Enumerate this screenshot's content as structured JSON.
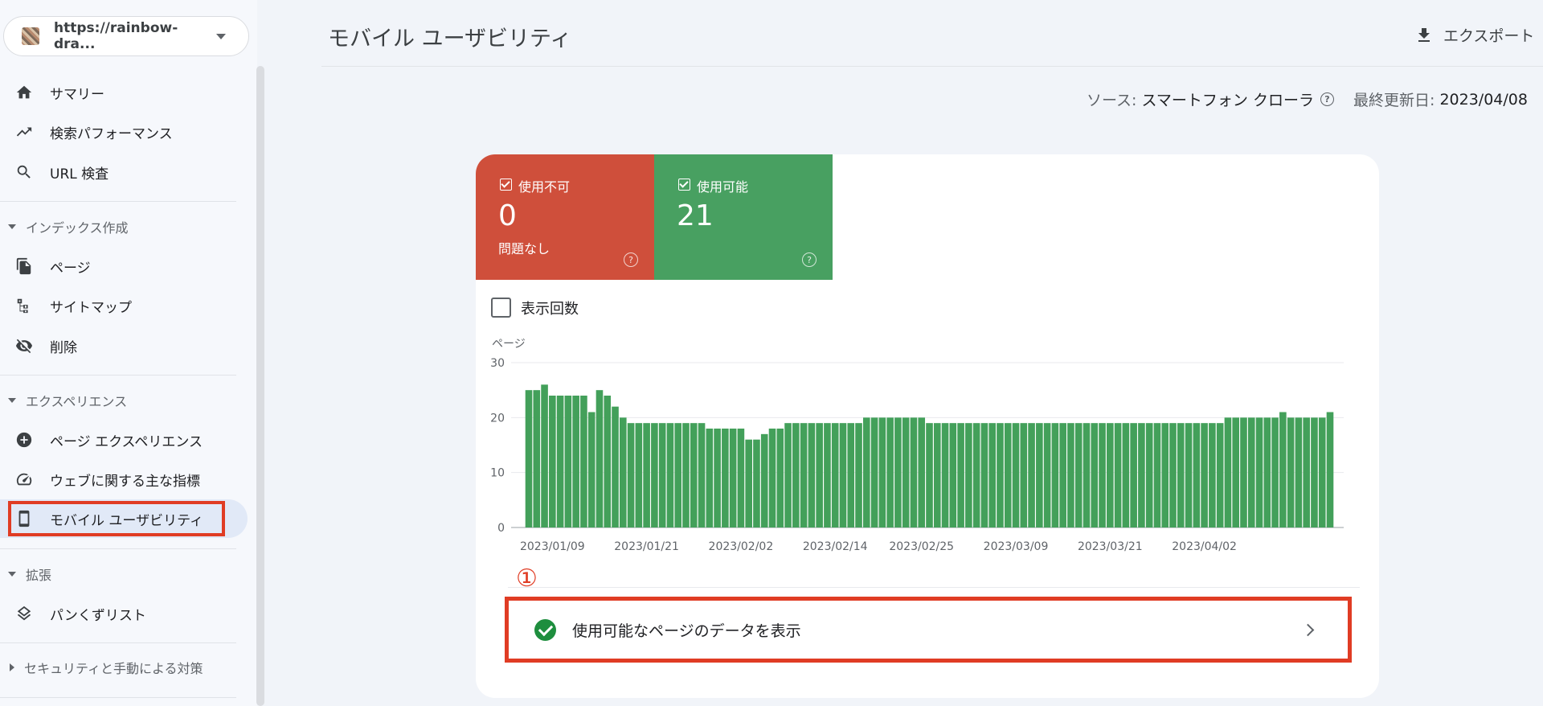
{
  "property": {
    "url": "https://rainbow-dra..."
  },
  "sidebar": {
    "items_top": [
      {
        "label": "サマリー",
        "icon": "home-icon"
      },
      {
        "label": "検索パフォーマンス",
        "icon": "trending-up-icon"
      },
      {
        "label": "URL 検査",
        "icon": "search-icon"
      }
    ],
    "indexing": {
      "header": "インデックス作成",
      "items": [
        {
          "label": "ページ",
          "icon": "pages-icon"
        },
        {
          "label": "サイトマップ",
          "icon": "sitemap-icon"
        },
        {
          "label": "削除",
          "icon": "eye-off-icon"
        }
      ]
    },
    "experience": {
      "header": "エクスペリエンス",
      "items": [
        {
          "label": "ページ エクスペリエンス",
          "icon": "page-experience-icon"
        },
        {
          "label": "ウェブに関する主な指標",
          "icon": "speedometer-icon"
        },
        {
          "label": "モバイル ユーザビリティ",
          "icon": "smartphone-icon"
        }
      ]
    },
    "enhancements": {
      "header": "拡張",
      "items": [
        {
          "label": "パンくずリスト",
          "icon": "layers-icon"
        }
      ]
    },
    "security": {
      "header": "セキュリティと手動による対策"
    }
  },
  "header": {
    "title": "モバイル ユーザビリティ",
    "export_label": "エクスポート"
  },
  "meta": {
    "source_label": "ソース:",
    "source_value": "スマートフォン クローラ",
    "updated_label": "最終更新日:",
    "updated_value": "2023/04/08"
  },
  "tiles": {
    "not_usable": {
      "label": "使用不可",
      "value": "0",
      "sub": "問題なし",
      "color": "#cf4f3b"
    },
    "usable": {
      "label": "使用可能",
      "value": "21",
      "color": "#48a061"
    }
  },
  "impressions_label": "表示回数",
  "chart_data": {
    "type": "bar",
    "ylabel": "ページ",
    "ylim": [
      0,
      30
    ],
    "yticks": [
      0,
      10,
      20,
      30
    ],
    "grid": true,
    "color": "#43a05a",
    "x_tick_labels": [
      "2023/01/09",
      "2023/01/21",
      "2023/02/02",
      "2023/02/14",
      "2023/02/25",
      "2023/03/09",
      "2023/03/21",
      "2023/04/02"
    ],
    "values": [
      25,
      25,
      26,
      24,
      24,
      24,
      24,
      24,
      21,
      25,
      24,
      22,
      20,
      19,
      19,
      19,
      19,
      19,
      19,
      19,
      19,
      19,
      19,
      18,
      18,
      18,
      18,
      18,
      16,
      16,
      17,
      18,
      18,
      19,
      19,
      19,
      19,
      19,
      19,
      19,
      19,
      19,
      19,
      20,
      20,
      20,
      20,
      20,
      20,
      20,
      20,
      19,
      19,
      19,
      19,
      19,
      19,
      19,
      19,
      19,
      19,
      19,
      19,
      19,
      19,
      19,
      19,
      19,
      19,
      19,
      19,
      19,
      19,
      19,
      19,
      19,
      19,
      19,
      19,
      19,
      19,
      19,
      19,
      19,
      19,
      19,
      19,
      19,
      19,
      20,
      20,
      20,
      20,
      20,
      20,
      20,
      21,
      20,
      20,
      20,
      20,
      20,
      21
    ]
  },
  "annotation": "①",
  "detail_row": {
    "label": "使用可能なページのデータを表示"
  }
}
